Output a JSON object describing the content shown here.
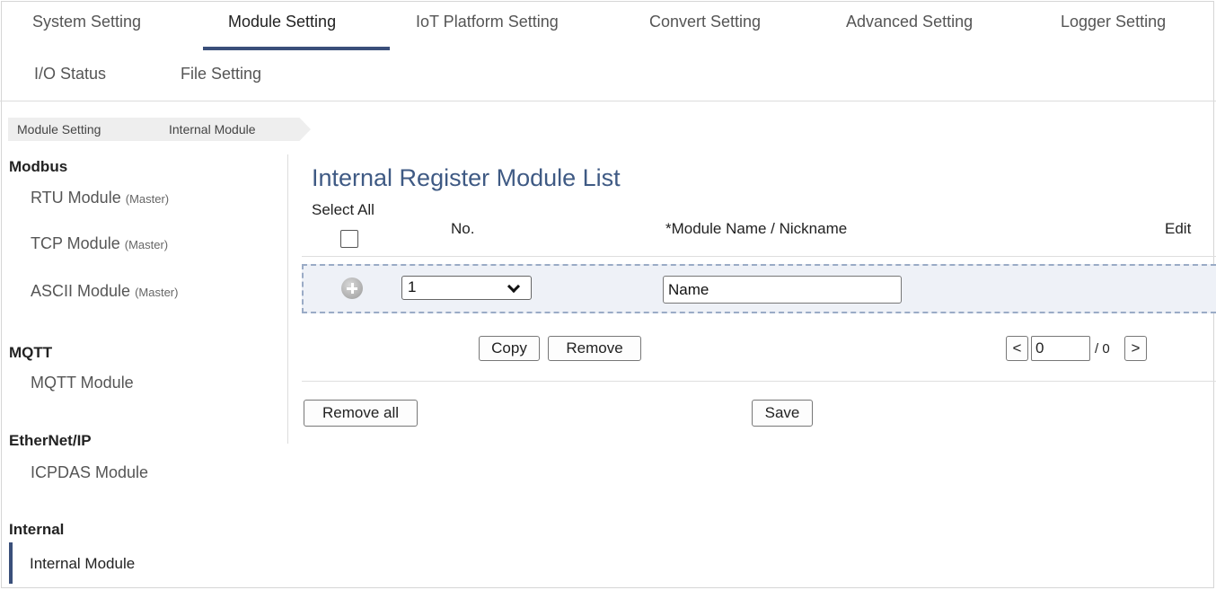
{
  "nav": {
    "tabs": [
      {
        "label": "System Setting"
      },
      {
        "label": "Module Setting",
        "active": true
      },
      {
        "label": "IoT Platform Setting"
      },
      {
        "label": "Convert Setting"
      },
      {
        "label": "Advanced Setting"
      },
      {
        "label": "Logger Setting"
      },
      {
        "label": "I/O Status"
      },
      {
        "label": "File Setting"
      }
    ]
  },
  "breadcrumb": [
    "Module Setting",
    "Internal Module"
  ],
  "sidebar": {
    "groups": [
      {
        "title": "Modbus",
        "items": [
          {
            "label": "RTU Module",
            "suffix": "(Master)"
          },
          {
            "label": "TCP Module",
            "suffix": "(Master)"
          },
          {
            "label": "ASCII Module",
            "suffix": "(Master)"
          }
        ]
      },
      {
        "title": "MQTT",
        "items": [
          {
            "label": "MQTT Module"
          }
        ]
      },
      {
        "title": "EtherNet/IP",
        "items": [
          {
            "label": "ICPDAS Module"
          }
        ]
      },
      {
        "title": "Internal",
        "items": [
          {
            "label": "Internal Module",
            "active": true
          }
        ]
      }
    ]
  },
  "main": {
    "title": "Internal Register Module List",
    "columns": {
      "select_all": "Select All",
      "no": "No.",
      "name": "*Module Name / Nickname",
      "edit": "Edit"
    },
    "row": {
      "no_value": "1",
      "name_value": "Name"
    },
    "buttons": {
      "copy": "Copy",
      "remove": "Remove",
      "remove_all": "Remove all",
      "save": "Save",
      "prev": "<",
      "next": ">"
    },
    "pager": {
      "page": "0",
      "total": "/ 0"
    }
  },
  "colors": {
    "accent": "#3a4f7a",
    "title": "#3f5a84",
    "row_highlight": "#eef1f7",
    "row_border": "#9aabc6"
  }
}
